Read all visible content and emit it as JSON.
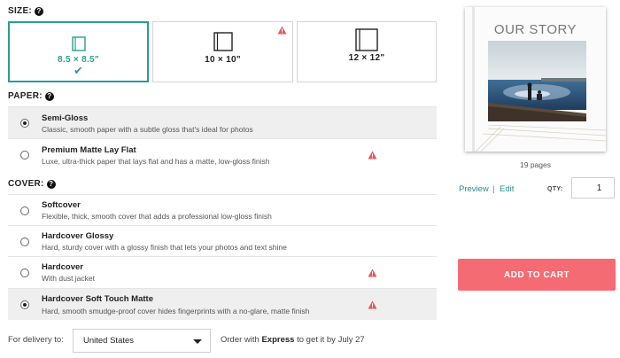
{
  "size": {
    "label": "SIZE:",
    "options": [
      {
        "label": "8.5 × 8.5\"",
        "selected": true,
        "warning": false
      },
      {
        "label": "10 × 10\"",
        "selected": false,
        "warning": true
      },
      {
        "label": "12 × 12\"",
        "selected": false,
        "warning": false
      }
    ]
  },
  "paper": {
    "label": "PAPER:",
    "options": [
      {
        "title": "Semi-Gloss",
        "desc": "Classic, smooth paper with a subtle gloss that's ideal for photos",
        "selected": true,
        "warning": false
      },
      {
        "title": "Premium Matte Lay Flat",
        "desc": "Luxe, ultra-thick paper that lays flat and has a matte, low-gloss finish",
        "selected": false,
        "warning": true
      }
    ]
  },
  "cover": {
    "label": "COVER:",
    "options": [
      {
        "title": "Softcover",
        "desc": "Flexible, thick, smooth cover that adds a professional low-gloss finish",
        "selected": false,
        "warning": false
      },
      {
        "title": "Hardcover Glossy",
        "desc": "Hard, sturdy cover with a glossy finish that lets your photos and text shine",
        "selected": false,
        "warning": false
      },
      {
        "title": "Hardcover",
        "desc": "With dust jacket",
        "selected": false,
        "warning": true
      },
      {
        "title": "Hardcover Soft Touch Matte",
        "desc": "Hard, smooth smudge-proof cover hides fingerprints with a no-glare, matte finish",
        "selected": true,
        "warning": true
      }
    ]
  },
  "delivery": {
    "label": "For delivery to:",
    "country": "United States",
    "order_prefix": "Order with ",
    "order_method": "Express",
    "order_suffix": " to get it by July 27"
  },
  "preview": {
    "book_title": "OUR STORY",
    "pages": "19 pages",
    "preview_link": "Preview",
    "separator": "|",
    "edit_link": "Edit",
    "qty_label": "QTY:",
    "qty_value": "1"
  },
  "cart": {
    "add_label": "ADD TO CART"
  },
  "colors": {
    "accent": "#2a9d8f",
    "cart": "#f56b73",
    "warning": "#e05a5a"
  }
}
